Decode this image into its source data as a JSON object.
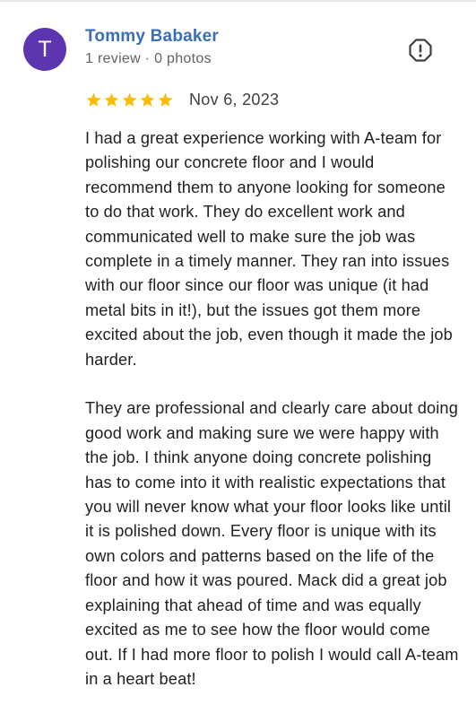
{
  "review": {
    "avatar_initial": "T",
    "reviewer_name": "Tommy Babaker",
    "reviewer_meta": "1 review · 0 photos",
    "rating": 5,
    "rating_max": 5,
    "date": "Nov 6, 2023",
    "paragraphs": [
      "I had a great experience working with A-team for polishing our concrete floor and I would recommend them to anyone looking for someone to do that work. They do excellent work and communicated well to make sure the job was complete in a timely manner. They ran into issues with our floor since our floor was unique (it had metal bits in it!), but the issues got them more excited about the job, even though it made the job harder.",
      "They are professional and clearly care about doing good work and making sure we were happy with the job. I think anyone doing concrete polishing has to come into it with realistic expectations that you will never know what your floor looks like until it is polished down. Every floor is unique with its own colors and patterns based on the life of the floor and how it was poured. Mack did a great job explaining that ahead of time and was equally excited as me to see how the floor would come out. If I had more floor to polish I would call A-team in a heart beat!"
    ]
  },
  "icons": {
    "report": "report-flag-icon",
    "star": "star-icon"
  },
  "colors": {
    "avatar_bg": "#5e35b1",
    "name": "#3c6db7",
    "star": "#fbbc04",
    "text": "#202124",
    "meta": "#5f6368"
  }
}
